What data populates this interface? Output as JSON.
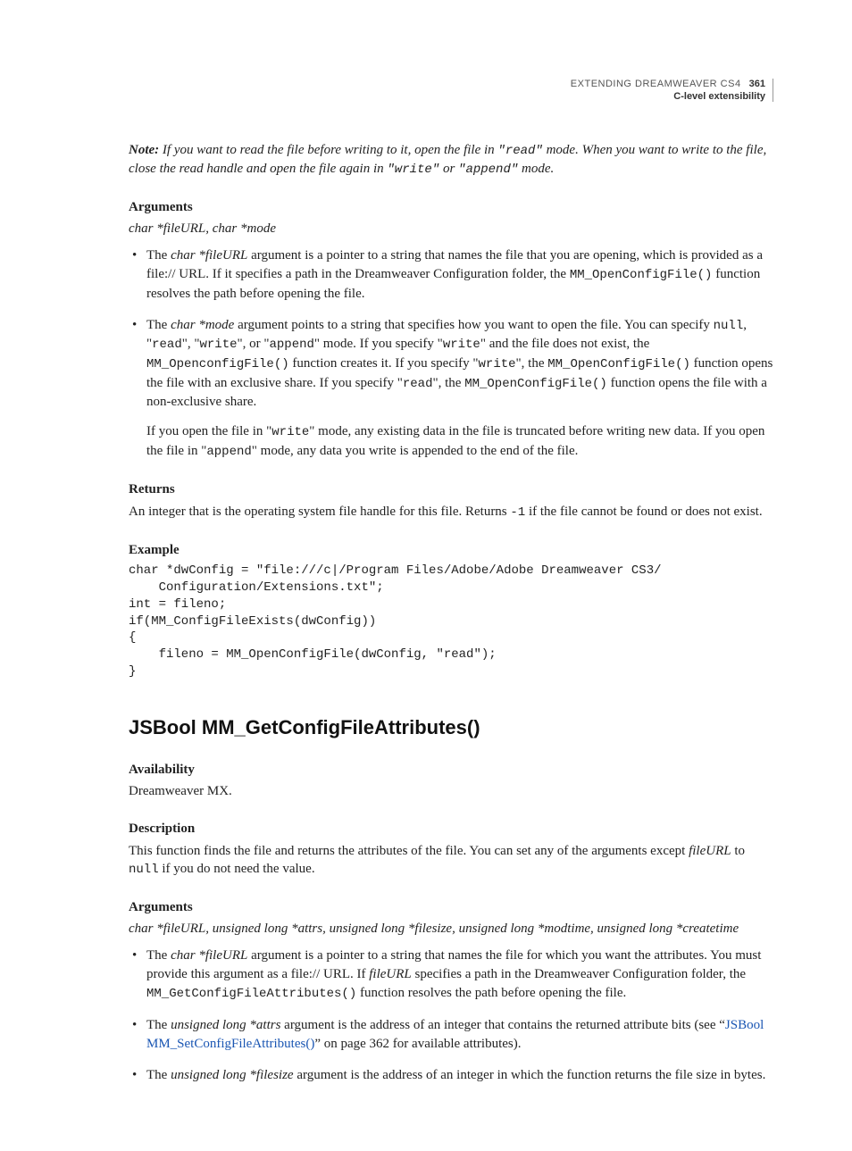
{
  "header": {
    "doc_title": "EXTENDING DREAMWEAVER CS4",
    "page_number": "361",
    "chapter": "C-level extensibility"
  },
  "note": {
    "label": "Note:",
    "text_1": " If you want to read the file before writing to it, open the file in ",
    "code_read": "\"read\"",
    "text_2": " mode. When you want to write to the file, close the read handle and open the file again in ",
    "code_write": "\"write\"",
    "text_or": " or ",
    "code_append": "\"append\"",
    "text_end": " mode."
  },
  "args1": {
    "label": "Arguments",
    "sig": "char *fileURL, char *mode",
    "li1_pre": "The ",
    "li1_arg": "char *fileURL",
    "li1_a": " argument is a pointer to a string that names the file that you are opening, which is provided as a file:// URL. If it specifies a path in the Dreamweaver Configuration folder, the ",
    "li1_code": "MM_OpenConfigFile()",
    "li1_b": " function resolves the path before opening the file.",
    "li2_pre": "The ",
    "li2_arg": "char *mode",
    "li2_a": " argument points to a string that specifies how you want to open the file. You can specify ",
    "li2_c_null": "null",
    "li2_b": ", \"",
    "li2_c_read": "read",
    "li2_c": "\", \"",
    "li2_c_write": "write",
    "li2_d": "\", or \"",
    "li2_c_append": "append",
    "li2_e": "\" mode. If you specify \"",
    "li2_c_write2": "write",
    "li2_f": "\" and the file does not exist, the ",
    "li2_c_fn1": "MM_OpenconfigFile()",
    "li2_g": " function creates it. If you specify \"",
    "li2_c_write3": "write",
    "li2_h": "\", the ",
    "li2_c_fn2": "MM_OpenConfigFile()",
    "li2_i": " function opens the file with an exclusive share. If you specify \"",
    "li2_c_read2": "read",
    "li2_j": "\", the ",
    "li2_c_fn3": "MM_OpenConfigFile()",
    "li2_k": " function opens the file with a non-exclusive share.",
    "li2_p2_a": "If you open the file in \"",
    "li2_p2_c1": "write",
    "li2_p2_b": "\" mode, any existing data in the file is truncated before writing new data. If you open the file in \"",
    "li2_p2_c2": "append",
    "li2_p2_c": "\" mode, any data you write is appended to the end of the file."
  },
  "returns": {
    "label": "Returns",
    "text": "An integer that is the operating system file handle for this file. Returns ",
    "code": "-1",
    "text_end": " if the file cannot be found or does not exist."
  },
  "example": {
    "label": "Example",
    "code": "char *dwConfig = \"file:///c|/Program Files/Adobe/Adobe Dreamweaver CS3/\n    Configuration/Extensions.txt\";\nint = fileno;\nif(MM_ConfigFileExists(dwConfig))\n{\n    fileno = MM_OpenConfigFile(dwConfig, \"read\");\n}"
  },
  "h2": "JSBool MM_GetConfigFileAttributes()",
  "avail": {
    "label": "Availability",
    "text": "Dreamweaver MX."
  },
  "desc": {
    "label": "Description",
    "text_a": "This function finds the file and returns the attributes of the file. You can set any of the arguments except ",
    "arg": "fileURL",
    "text_b": " to ",
    "code": "null",
    "text_c": " if you do not need the value."
  },
  "args2": {
    "label": "Arguments",
    "sig": "char *fileURL, unsigned long *attrs, unsigned long *filesize, unsigned long *modtime, unsigned long *createtime",
    "li1_pre": "The ",
    "li1_arg": "char *fileURL",
    "li1_a": " argument is a pointer to a string that names the file for which you want the attributes. You must provide this argument as a file:// URL. If ",
    "li1_arg2": "fileURL",
    "li1_b": " specifies a path in the Dreamweaver Configuration folder, the ",
    "li1_code": "MM_GetConfigFileAttributes()",
    "li1_c": " function resolves the path before opening the file.",
    "li2_pre": "The ",
    "li2_arg": "unsigned long *attrs",
    "li2_a": " argument is the address of an integer that contains the returned attribute bits (see “",
    "li2_link": "JSBool MM_SetConfigFileAttributes()",
    "li2_b": "” on page 362 for available attributes).",
    "li3_pre": "The ",
    "li3_arg": "unsigned long *filesize",
    "li3_a": " argument is the address of an integer in which the function returns the file size in bytes."
  }
}
